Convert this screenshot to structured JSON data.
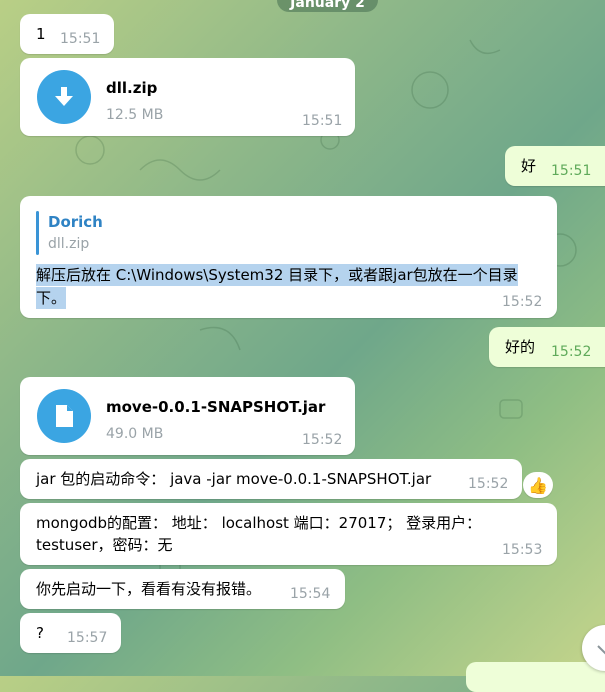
{
  "date_label": "January 2",
  "messages": [
    {
      "id": "m1",
      "text": "1",
      "time": "15:51"
    },
    {
      "id": "m2",
      "file_name": "dll.zip",
      "file_size": "12.5 MB",
      "time": "15:51",
      "icon": "download-icon"
    },
    {
      "id": "m3",
      "text": "好",
      "time": "15:51"
    },
    {
      "id": "m4",
      "quote_author": "Dorich",
      "quote_text": "dll.zip",
      "text_line1": "解压后放在 C:\\Windows\\System32 目录下，或者跟jar包放在一个目录",
      "text_line2": "下。",
      "time": "15:52"
    },
    {
      "id": "m5",
      "text": "好的",
      "time": "15:52"
    },
    {
      "id": "m6",
      "file_name": "move-0.0.1-SNAPSHOT.jar",
      "file_size": "49.0 MB",
      "time": "15:52",
      "icon": "file-icon"
    },
    {
      "id": "m7",
      "text": "jar 包的启动命令： java   -jar    move-0.0.1-SNAPSHOT.jar",
      "time": "15:52",
      "reaction": "👍"
    },
    {
      "id": "m8",
      "text_line1": "mongodb的配置：  地址：  localhost 端口：27017；  登录用户：",
      "text_line2": "testuser，密码：无",
      "time": "15:53"
    },
    {
      "id": "m9",
      "text": "你先启动一下，看看有没有报错。",
      "time": "15:54"
    },
    {
      "id": "m10",
      "text": "?",
      "time": "15:57"
    }
  ],
  "colors": {
    "incoming": "#ffffff",
    "outgoing": "#eefed8",
    "accent": "#3ba5e2",
    "quote": "#2f83c4",
    "selection": "#b5d3ee"
  }
}
